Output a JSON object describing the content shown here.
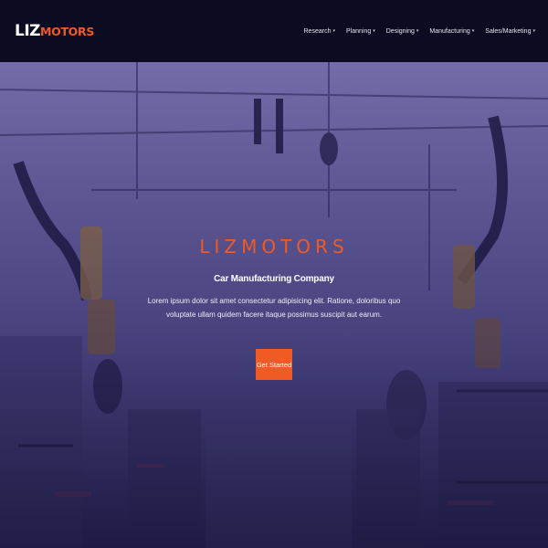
{
  "brand": {
    "part1": "LIZ",
    "part2": "MOTORS",
    "accent_color": "#f05a24"
  },
  "nav": {
    "items": [
      {
        "label": "Research",
        "caret": "▾"
      },
      {
        "label": "Planning",
        "caret": "▾"
      },
      {
        "label": "Designing",
        "caret": "▾"
      },
      {
        "label": "Manufacturing",
        "caret": "▾"
      },
      {
        "label": "Sales/Marketing",
        "caret": "▾"
      }
    ]
  },
  "hero": {
    "title": "LIZMOTORS",
    "subtitle": "Car Manufacturing Company",
    "description": "Lorem ipsum dolor sit amet consectetur adipisicing elit. Ratione, doloribus quo voluptate ullam quidem facere itaque possimus suscipit aut earum.",
    "cta_label": "Get Started",
    "background_image": "factory-robot-arms"
  }
}
